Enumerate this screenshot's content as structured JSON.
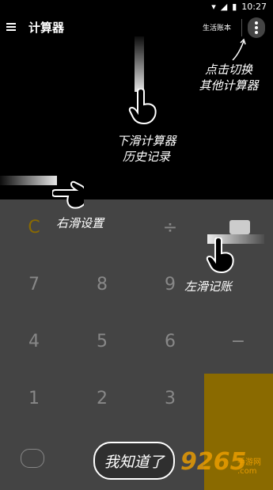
{
  "status_bar": {
    "time": "10:27"
  },
  "app_bar": {
    "title": "计算器",
    "life_ledger_label": "生活账本"
  },
  "hints": {
    "switch_calculator": [
      "点击切换",
      "其他计算器"
    ],
    "history": [
      "下滑计算器",
      "历史记录"
    ],
    "settings": "右滑设置",
    "ledger": "左滑记账"
  },
  "keypad": {
    "rows": [
      [
        "C",
        "",
        "÷",
        ""
      ],
      [
        "7",
        "8",
        "9",
        ""
      ],
      [
        "4",
        "5",
        "6",
        "−"
      ],
      [
        "1",
        "2",
        "3",
        ""
      ],
      [
        "",
        "",
        "",
        ""
      ]
    ]
  },
  "got_it_button": "我知道了",
  "watermark": {
    "number": "9265",
    "site": "手游网",
    "domain": ".com"
  },
  "colors": {
    "accent": "#8a6a00",
    "background": "#000000",
    "keypad_bg": "#444444"
  }
}
